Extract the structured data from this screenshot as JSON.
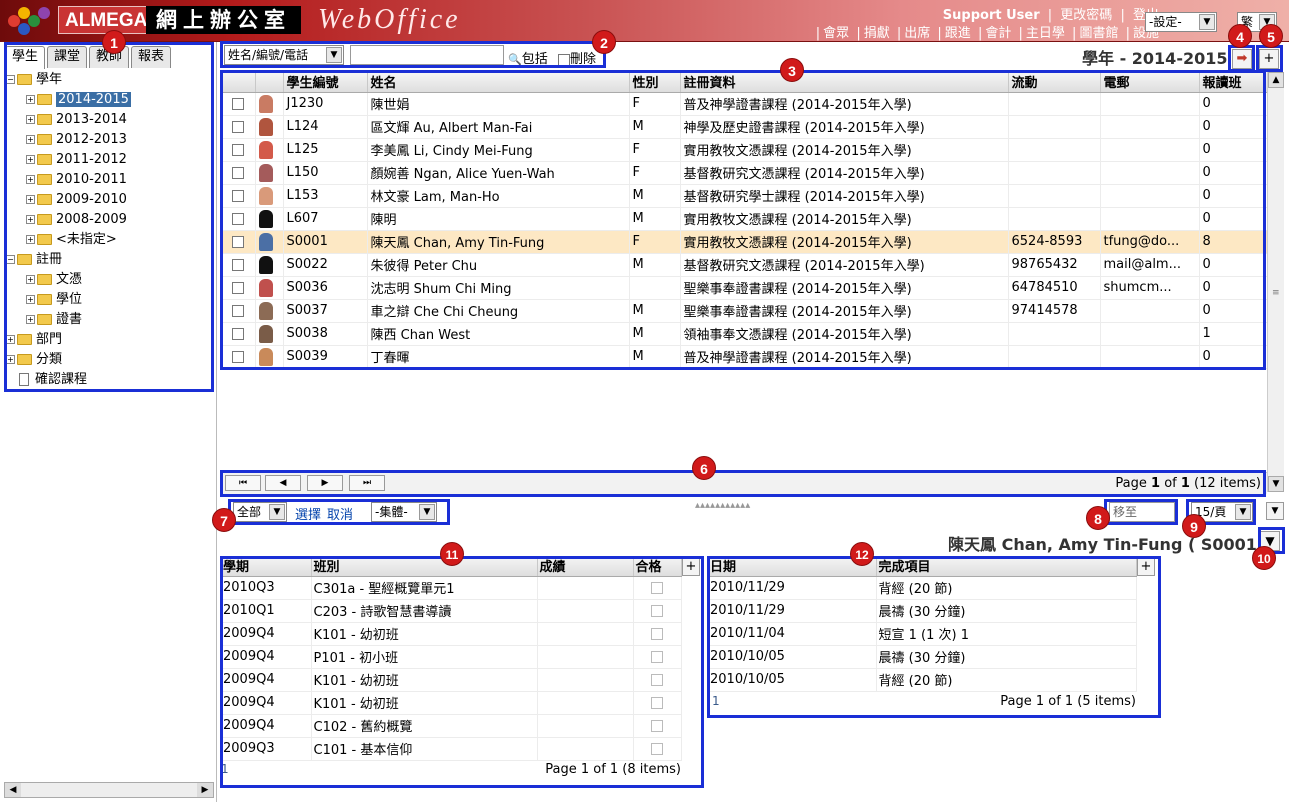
{
  "header": {
    "brand": "ALMEGA",
    "office_name": "網上辦公室",
    "app_name": "WebOffice",
    "user": "Support User",
    "links_top": [
      "更改密碼",
      "登出"
    ],
    "links_bottom": [
      "會眾",
      "捐獻",
      "出席",
      "跟進",
      "會計",
      "主日學",
      "圖書館",
      "設施"
    ],
    "settings_select": "-設定-",
    "lang_select": "繁"
  },
  "left": {
    "tabs": [
      "學生",
      "課堂",
      "教師",
      "報表"
    ],
    "tree": [
      {
        "label": "學年",
        "level": 0,
        "type": "open"
      },
      {
        "label": "2014-2015",
        "level": 1,
        "type": "closed",
        "selected": true
      },
      {
        "label": "2013-2014",
        "level": 1,
        "type": "closed"
      },
      {
        "label": "2012-2013",
        "level": 1,
        "type": "closed"
      },
      {
        "label": "2011-2012",
        "level": 1,
        "type": "closed"
      },
      {
        "label": "2010-2011",
        "level": 1,
        "type": "closed"
      },
      {
        "label": "2009-2010",
        "level": 1,
        "type": "closed"
      },
      {
        "label": "2008-2009",
        "level": 1,
        "type": "closed"
      },
      {
        "label": "<未指定>",
        "level": 1,
        "type": "closed"
      },
      {
        "label": "註冊",
        "level": 0,
        "type": "open"
      },
      {
        "label": "文憑",
        "level": 1,
        "type": "closed"
      },
      {
        "label": "學位",
        "level": 1,
        "type": "closed"
      },
      {
        "label": "證書",
        "level": 1,
        "type": "closed"
      },
      {
        "label": "部門",
        "level": 0,
        "type": "closed"
      },
      {
        "label": "分類",
        "level": 0,
        "type": "closed"
      },
      {
        "label": "確認課程",
        "level": 0,
        "type": "doc"
      }
    ]
  },
  "search": {
    "field_select": "姓名/編號/電話",
    "query": "",
    "include_label": "包括",
    "delete_label": "刪除"
  },
  "year_title": "學年 - 2014-2015",
  "students": {
    "columns": [
      "學生編號",
      "姓名",
      "性別",
      "註冊資料",
      "流動",
      "電郵",
      "報讀班"
    ],
    "rows": [
      {
        "id": "J1230",
        "name": "陳世娟",
        "gender": "F",
        "reg": "普及神學證書課程 (2014-2015年入學)",
        "mobile": "",
        "email": "",
        "classes": "0",
        "avatar": "#c97b63"
      },
      {
        "id": "L124",
        "name": "區文輝 Au, Albert Man-Fai",
        "gender": "M",
        "reg": "神學及歷史證書課程 (2014-2015年入學)",
        "mobile": "",
        "email": "",
        "classes": "0",
        "avatar": "#b0553e"
      },
      {
        "id": "L125",
        "name": "李美鳳 Li, Cindy Mei-Fung",
        "gender": "F",
        "reg": "實用教牧文憑課程 (2014-2015年入學)",
        "mobile": "",
        "email": "",
        "classes": "0",
        "avatar": "#d35a4a"
      },
      {
        "id": "L150",
        "name": "顏婉善 Ngan, Alice Yuen-Wah",
        "gender": "F",
        "reg": "基督教研究文憑課程 (2014-2015年入學)",
        "mobile": "",
        "email": "",
        "classes": "0",
        "avatar": "#a45b5b"
      },
      {
        "id": "L153",
        "name": "林文豪 Lam, Man-Ho",
        "gender": "M",
        "reg": "基督教研究學士課程 (2014-2015年入學)",
        "mobile": "",
        "email": "",
        "classes": "0",
        "avatar": "#d99a7a"
      },
      {
        "id": "L607",
        "name": "陳明",
        "gender": "M",
        "reg": "實用教牧文憑課程 (2014-2015年入學)",
        "mobile": "",
        "email": "",
        "classes": "0",
        "avatar": "#111111"
      },
      {
        "id": "S0001",
        "name": "陳天鳳 Chan, Amy Tin-Fung",
        "gender": "F",
        "reg": "實用教牧文憑課程 (2014-2015年入學)",
        "mobile": "6524-8593",
        "email": "tfung@do...",
        "classes": "8",
        "avatar": "#4b6fa5",
        "highlight": true
      },
      {
        "id": "S0022",
        "name": "朱彼得 Peter Chu",
        "gender": "M",
        "reg": "基督教研究文憑課程 (2014-2015年入學)",
        "mobile": "98765432",
        "email": "mail@alm...",
        "classes": "0",
        "avatar": "#111111"
      },
      {
        "id": "S0036",
        "name": "沈志明 Shum Chi Ming",
        "gender": "",
        "reg": "聖樂事奉證書課程 (2014-2015年入學)",
        "mobile": "64784510",
        "email": "shumcm...",
        "classes": "0",
        "avatar": "#c0504d"
      },
      {
        "id": "S0037",
        "name": "車之辯 Che Chi Cheung",
        "gender": "M",
        "reg": "聖樂事奉證書課程 (2014-2015年入學)",
        "mobile": "97414578",
        "email": "",
        "classes": "0",
        "avatar": "#8c6b55"
      },
      {
        "id": "S0038",
        "name": "陳西 Chan West",
        "gender": "M",
        "reg": "領袖事奉文憑課程 (2014-2015年入學)",
        "mobile": "",
        "email": "",
        "classes": "1",
        "avatar": "#7a5c48"
      },
      {
        "id": "S0039",
        "name": "丁春暉",
        "gender": "M",
        "reg": "普及神學證書課程 (2014-2015年入學)",
        "mobile": "",
        "email": "",
        "classes": "0",
        "avatar": "#c98a5a"
      }
    ]
  },
  "pager": {
    "page_prefix": "Page ",
    "page": "1",
    "of": " of ",
    "total_pages": "1",
    "items": " (12 items)"
  },
  "actions": {
    "select_scope": "全部",
    "select_label": "選擇",
    "cancel_label": "取消",
    "group_select": "-集體-",
    "move_to": "移至",
    "per_page": "15/頁"
  },
  "detail": {
    "title": "陳天鳳 Chan, Amy Tin-Fung ( S0001 )",
    "classes": {
      "columns": [
        "學期",
        "班別",
        "成績",
        "合格"
      ],
      "rows": [
        {
          "term": "2010Q3",
          "class": "C301a - 聖經概覽單元1",
          "grade": ""
        },
        {
          "term": "2010Q1",
          "class": "C203 - 詩歌智慧書導讀",
          "grade": ""
        },
        {
          "term": "2009Q4",
          "class": "K101 - 幼初班",
          "grade": ""
        },
        {
          "term": "2009Q4",
          "class": "P101 - 初小班",
          "grade": ""
        },
        {
          "term": "2009Q4",
          "class": "K101 - 幼初班",
          "grade": ""
        },
        {
          "term": "2009Q4",
          "class": "K101 - 幼初班",
          "grade": ""
        },
        {
          "term": "2009Q4",
          "class": "C102 - 舊約概覽",
          "grade": ""
        },
        {
          "term": "2009Q3",
          "class": "C101 - 基本信仰",
          "grade": ""
        }
      ],
      "footer_num": "1",
      "pager": "Page 1 of 1 (8 items)"
    },
    "progress": {
      "columns": [
        "日期",
        "完成項目"
      ],
      "rows": [
        {
          "date": "2010/11/29",
          "item": "背經 (20 節)"
        },
        {
          "date": "2010/11/29",
          "item": "晨禱 (30 分鐘)"
        },
        {
          "date": "2010/11/04",
          "item": "短宣 1 (1 次) 1"
        },
        {
          "date": "2010/10/05",
          "item": "晨禱 (30 分鐘)"
        },
        {
          "date": "2010/10/05",
          "item": "背經 (20 節)"
        }
      ],
      "footer_num": "1",
      "pager": "Page 1 of 1 (5 items)"
    }
  },
  "callouts": [
    "1",
    "2",
    "3",
    "4",
    "5",
    "6",
    "7",
    "8",
    "9",
    "10",
    "11",
    "12"
  ],
  "colors": {
    "callout_box": "#1a2fd6",
    "callout_badge": "#d11a1a",
    "highlight_row": "#fde8c4",
    "header_red": "#b31b1b"
  }
}
